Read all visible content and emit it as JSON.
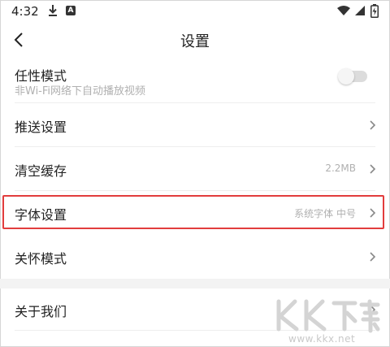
{
  "status_bar": {
    "time": "4:32",
    "app_badge": "A"
  },
  "header": {
    "title": "设置"
  },
  "rows": {
    "wayward": {
      "label": "任性模式",
      "sub": "非Wi-Fi网络下自动播放视频",
      "toggle_on": false
    },
    "push": {
      "label": "推送设置"
    },
    "cache": {
      "label": "清空缓存",
      "value": "2.2MB"
    },
    "font": {
      "label": "字体设置",
      "value": "系统字体 中号"
    },
    "care": {
      "label": "关怀模式"
    },
    "about": {
      "label": "关于我们"
    }
  },
  "colors": {
    "highlight": "#e23d3d",
    "secondary_text": "#b0b0b0"
  },
  "watermark": {
    "url": "www.kkx.net"
  }
}
